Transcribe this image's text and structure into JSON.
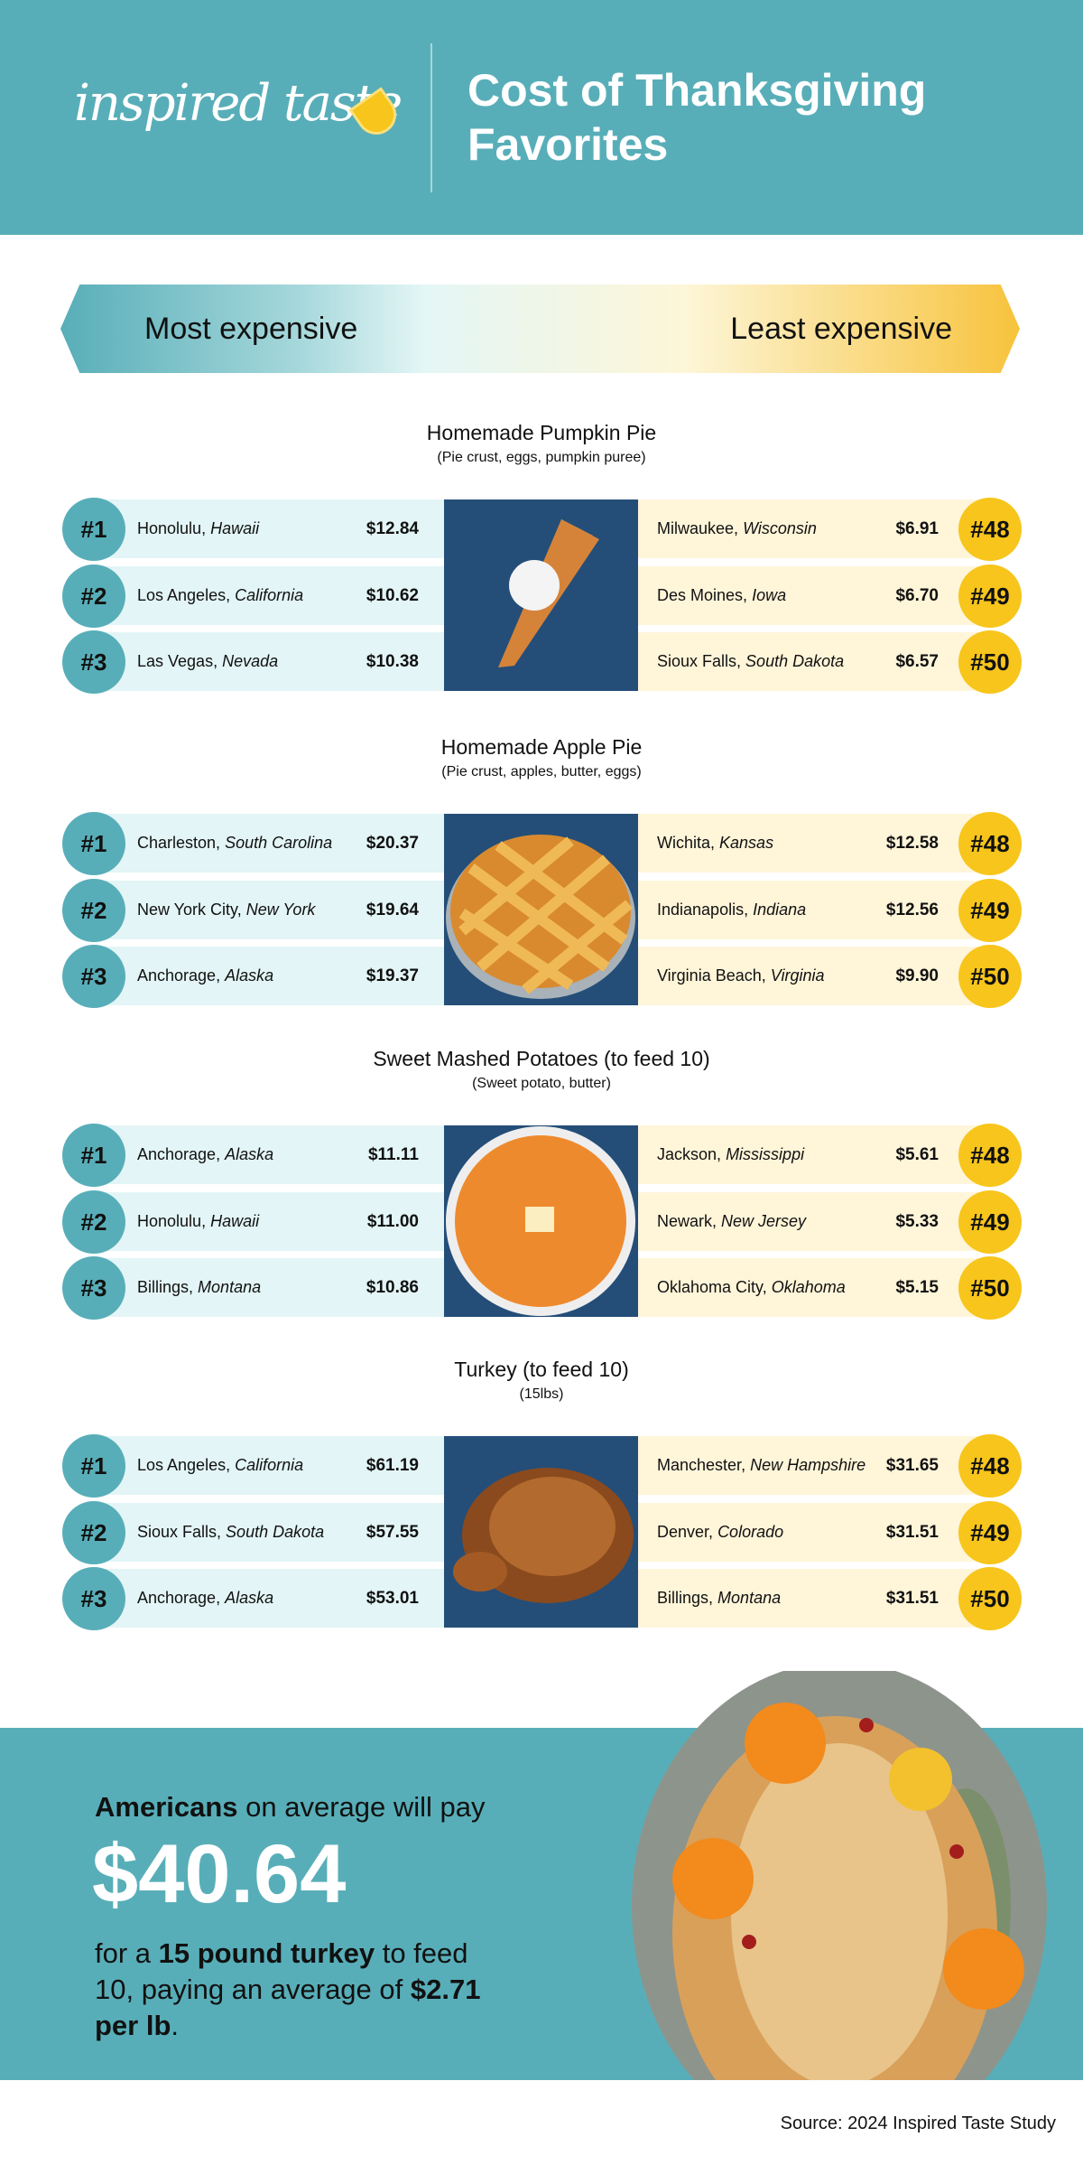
{
  "header": {
    "logo": "inspired taste",
    "title": "Cost of Thanksgiving Favorites"
  },
  "scale": {
    "left": "Most expensive",
    "right": "Least expensive",
    "colors": {
      "teal": "#58aeb8",
      "yellow": "#f7c51b"
    }
  },
  "sections": [
    {
      "title": "Homemade Pumpkin Pie",
      "subtitle": "(Pie crust, eggs, pumpkin puree)",
      "image": "pumpkin-pie",
      "most": [
        {
          "rank": "#1",
          "city": "Honolulu",
          "state": "Hawaii",
          "price": "$12.84"
        },
        {
          "rank": "#2",
          "city": "Los Angeles",
          "state": "California",
          "price": "$10.62"
        },
        {
          "rank": "#3",
          "city": "Las Vegas",
          "state": "Nevada",
          "price": "$10.38"
        }
      ],
      "least": [
        {
          "rank": "#48",
          "city": "Milwaukee",
          "state": "Wisconsin",
          "price": "$6.91"
        },
        {
          "rank": "#49",
          "city": "Des Moines",
          "state": "Iowa",
          "price": "$6.70"
        },
        {
          "rank": "#50",
          "city": "Sioux Falls",
          "state": "South Dakota",
          "price": "$6.57"
        }
      ]
    },
    {
      "title": "Homemade Apple Pie",
      "subtitle": "(Pie crust, apples, butter, eggs)",
      "image": "apple-pie",
      "most": [
        {
          "rank": "#1",
          "city": "Charleston",
          "state": "South Carolina",
          "price": "$20.37"
        },
        {
          "rank": "#2",
          "city": "New York City",
          "state": "New York",
          "price": "$19.64"
        },
        {
          "rank": "#3",
          "city": "Anchorage",
          "state": "Alaska",
          "price": "$19.37"
        }
      ],
      "least": [
        {
          "rank": "#48",
          "city": "Wichita",
          "state": "Kansas",
          "price": "$12.58"
        },
        {
          "rank": "#49",
          "city": "Indianapolis",
          "state": "Indiana",
          "price": "$12.56"
        },
        {
          "rank": "#50",
          "city": "Virginia Beach",
          "state": "Virginia",
          "price": "$9.90"
        }
      ]
    },
    {
      "title": "Sweet Mashed Potatoes (to feed 10)",
      "subtitle": "(Sweet potato, butter)",
      "image": "sweet-potatoes",
      "most": [
        {
          "rank": "#1",
          "city": "Anchorage",
          "state": "Alaska",
          "price": "$11.11"
        },
        {
          "rank": "#2",
          "city": "Honolulu",
          "state": "Hawaii",
          "price": "$11.00"
        },
        {
          "rank": "#3",
          "city": "Billings",
          "state": "Montana",
          "price": "$10.86"
        }
      ],
      "least": [
        {
          "rank": "#48",
          "city": "Jackson",
          "state": "Mississippi",
          "price": "$5.61"
        },
        {
          "rank": "#49",
          "city": "Newark",
          "state": "New Jersey",
          "price": "$5.33"
        },
        {
          "rank": "#50",
          "city": "Oklahoma City",
          "state": "Oklahoma",
          "price": "$5.15"
        }
      ]
    },
    {
      "title": "Turkey (to feed 10)",
      "subtitle": "(15lbs)",
      "image": "turkey",
      "most": [
        {
          "rank": "#1",
          "city": "Los Angeles",
          "state": "California",
          "price": "$61.19"
        },
        {
          "rank": "#2",
          "city": "Sioux Falls",
          "state": "South Dakota",
          "price": "$57.55"
        },
        {
          "rank": "#3",
          "city": "Anchorage",
          "state": "Alaska",
          "price": "$53.01"
        }
      ],
      "least": [
        {
          "rank": "#48",
          "city": "Manchester",
          "state": "New Hampshire",
          "price": "$31.65"
        },
        {
          "rank": "#49",
          "city": "Denver",
          "state": "Colorado",
          "price": "$31.51"
        },
        {
          "rank": "#50",
          "city": "Billings",
          "state": "Montana",
          "price": "$31.51"
        }
      ]
    }
  ],
  "banner": {
    "line1_bold": "Americans",
    "line1_rest": " on average will pay",
    "amount": "$40.64",
    "l2a": "for a ",
    "l2b": "15 pound turkey",
    "l2c": " to feed 10, paying an average of ",
    "l2d": "$2.71 per lb",
    "l2e": "."
  },
  "source": "Source: 2024 Inspired Taste Study"
}
